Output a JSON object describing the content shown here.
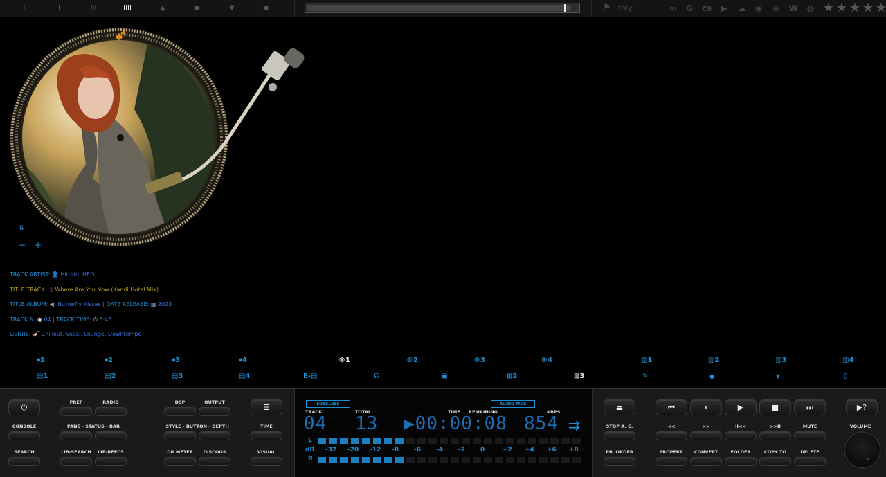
{
  "topbar": {
    "layout_buttons": [
      "I",
      "II",
      "III",
      "IIII",
      "▲",
      "◼",
      "▼",
      "◼"
    ],
    "active_layout": 3,
    "seek_progress_fraction": 0.97,
    "country": "Italy",
    "services": [
      "lastfm-icon",
      "google-icon",
      "lastfm-logo-icon",
      "youtube-icon",
      "soundcloud-icon",
      "spotify-icon",
      "allmusic-icon",
      "wikipedia-icon",
      "podcast-icon"
    ],
    "service_glyphs": [
      "∞",
      "G",
      "cs",
      "▶",
      "☁",
      "◉",
      "⊙",
      "W",
      "◍"
    ],
    "rating_stars": 5,
    "rating_filled": 0
  },
  "track": {
    "artist_label": "TRACK ARTIST:",
    "artist_value": "Hirudo, HED",
    "title_label": "TITLE TRACK:",
    "title_value": "Where Are You Now (Kandi Hotel Mix)",
    "album_label": "TITLE ALBUM:",
    "album_value": "Butterfly Kisses",
    "date_label": "| DATE RELEASE:",
    "date_value": "2023",
    "number_label": "TRACK N.",
    "number_value": "04",
    "time_label": "| TRACK TIME:",
    "time_value": "5:45",
    "genre_label": "GENRE:",
    "genre_value": "Chillout, Vocal, Lounge, Downtempo"
  },
  "vinyl_controls": {
    "swap": "⇅",
    "minus": "−",
    "plus": "+"
  },
  "presets_row1": [
    {
      "icon": "⏺",
      "label": "1",
      "name": "disc-preset-1"
    },
    {
      "icon": "⏺",
      "label": "2",
      "name": "disc-preset-2"
    },
    {
      "icon": "⏺",
      "label": "3",
      "name": "disc-preset-3"
    },
    {
      "icon": "⏺",
      "label": "4",
      "name": "disc-preset-4"
    },
    {
      "icon": "®",
      "label": "1",
      "name": "radio-preset-1"
    },
    {
      "icon": "®",
      "label": "2",
      "name": "radio-preset-2"
    },
    {
      "icon": "®",
      "label": "3",
      "name": "radio-preset-3"
    },
    {
      "icon": "®",
      "label": "4",
      "name": "radio-preset-4"
    },
    {
      "icon": "▥",
      "label": "1",
      "name": "meter-preset-1"
    },
    {
      "icon": "▥",
      "label": "2",
      "name": "meter-preset-2"
    },
    {
      "icon": "▥",
      "label": "3",
      "name": "meter-preset-3"
    },
    {
      "icon": "▥",
      "label": "4",
      "name": "meter-preset-4"
    }
  ],
  "presets_row2": [
    {
      "icon": "▤",
      "label": "1",
      "name": "doc-preset-1"
    },
    {
      "icon": "▤",
      "label": "2",
      "name": "doc-preset-2"
    },
    {
      "icon": "▤",
      "label": "3",
      "name": "doc-preset-3"
    },
    {
      "icon": "▤",
      "label": "4",
      "name": "doc-preset-4"
    },
    {
      "icon": "E-▤",
      "label": "",
      "name": "edit-doc-button"
    },
    {
      "icon": "☊",
      "label": "",
      "name": "headphones-button"
    },
    {
      "icon": "▣",
      "label": "",
      "name": "image-button"
    },
    {
      "icon": "⊞",
      "label": "2",
      "name": "grid-preset-2"
    },
    {
      "icon": "⊞",
      "label": "3",
      "name": "grid-preset-3"
    },
    {
      "icon": "✎",
      "label": "",
      "name": "pin-button"
    },
    {
      "icon": "●",
      "label": "",
      "name": "search-tool-button"
    },
    {
      "icon": "▼",
      "label": "",
      "name": "trash-button"
    },
    {
      "icon": "▯",
      "label": "",
      "name": "info-button"
    }
  ],
  "left_buttons": {
    "pref": "PREF",
    "radio": "RADIO",
    "dsp": "DSP",
    "output": "OUTPUT",
    "console": "CONSOLE",
    "pane_status_bar": "PANE - STATUS - BAR",
    "style_button_depth": "STYLE - BUTTON - DEPTH",
    "time": "TIME",
    "search": "SEARCH",
    "lib_search": "LIB-SEARCH",
    "lib_refcs": "LIB-REFCS",
    "dr_meter": "DR METER",
    "discogs": "DISCOGS",
    "visual": "VISUAL"
  },
  "display": {
    "lossless": "LOSSLESS",
    "audio_mode": "AUDIO MDS",
    "track_label": "TRACK",
    "total_label": "TOTAL",
    "time_label": "TIME",
    "remaining_label": "REMAINING",
    "kbps_label": "KBPS",
    "track_value": "04",
    "total_value": "13",
    "time_value": "▶00:00:08",
    "kbps_value": "854",
    "meter_L": "L",
    "meter_dB": "dB",
    "meter_R": "R",
    "db_scale": [
      "-32",
      "-20",
      "-12",
      "-8",
      "-6",
      "-4",
      "-2",
      "0",
      "+2",
      "+4",
      "+6",
      "+8"
    ],
    "meter_level_L": 8,
    "meter_level_R": 8,
    "meter_total_cells": 24
  },
  "right_buttons": {
    "stop_ac": "STOP A. C.",
    "pb_order": "PB. ORDER",
    "rew": "<<",
    "ff": ">>",
    "prev_pause": "II<<",
    "next_pause": ">>II",
    "mute": "MUTE",
    "propert": "PROPERT.",
    "convert": "CONVERT",
    "folder": "FOLDER",
    "copy_to": "COPY TO",
    "delete": "DELETE",
    "volume": "VOLUME",
    "help": "▶?"
  }
}
